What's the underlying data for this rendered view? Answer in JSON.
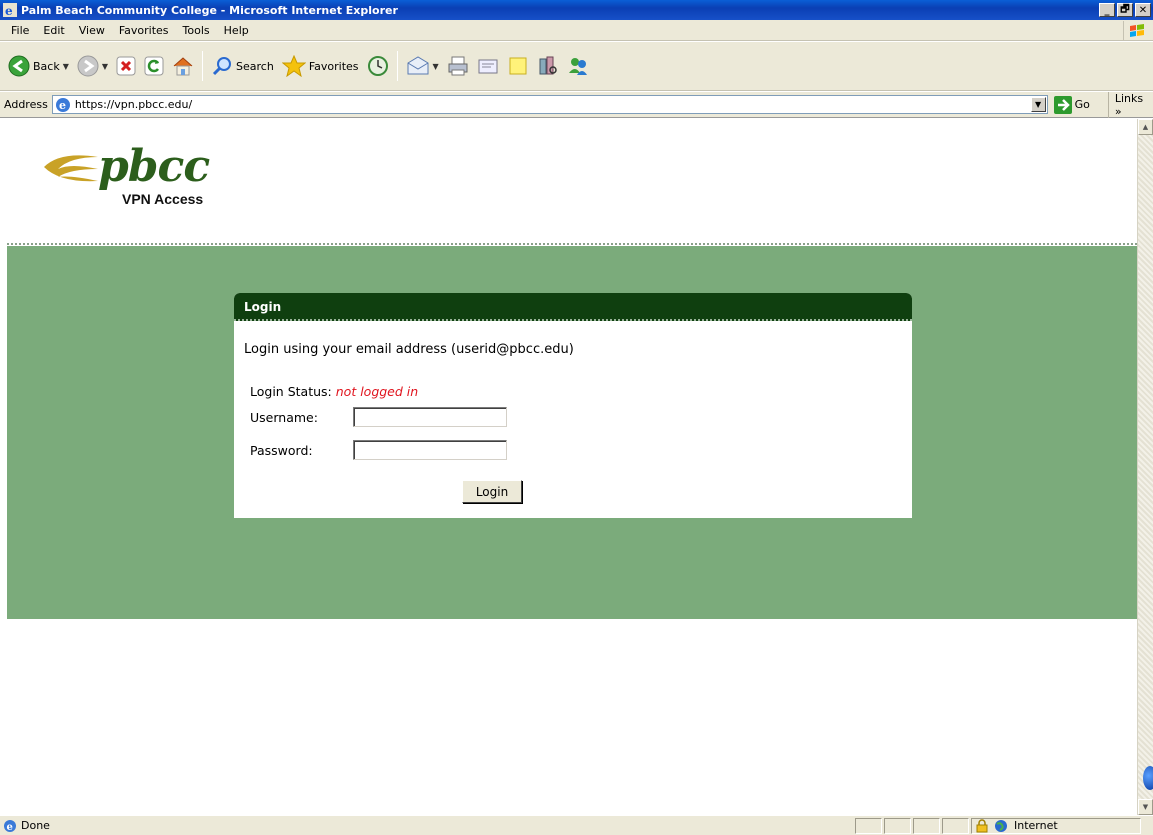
{
  "window": {
    "title": "Palm Beach Community College - Microsoft Internet Explorer",
    "controls": [
      "_",
      "🗗",
      "✕"
    ]
  },
  "menubar": {
    "items": [
      {
        "label": "File"
      },
      {
        "label": "Edit"
      },
      {
        "label": "View"
      },
      {
        "label": "Favorites"
      },
      {
        "label": "Tools"
      },
      {
        "label": "Help"
      }
    ]
  },
  "toolbar": {
    "back_label": "Back",
    "search_label": "Search",
    "favorites_label": "Favorites"
  },
  "addressbar": {
    "label": "Address",
    "url": "https://vpn.pbcc.edu/",
    "go_label": "Go",
    "links_label": "Links »"
  },
  "page": {
    "logo_text": "pbcc",
    "logo_subtitle": "VPN Access",
    "login_header": "Login",
    "login_description": "Login using your email address (userid@pbcc.edu)",
    "status_label": "Login Status:",
    "status_value": "not logged in",
    "username_label": "Username:",
    "password_label": "Password:",
    "username_value": "",
    "password_value": "",
    "login_button": "Login"
  },
  "statusbar": {
    "text": "Done",
    "zone": "Internet"
  },
  "colors": {
    "band_green": "#7bab7b",
    "header_green": "#0f3f0f",
    "logo_green": "#2c5e1c",
    "logo_gold": "#c9a227",
    "status_red": "#e0141e"
  }
}
